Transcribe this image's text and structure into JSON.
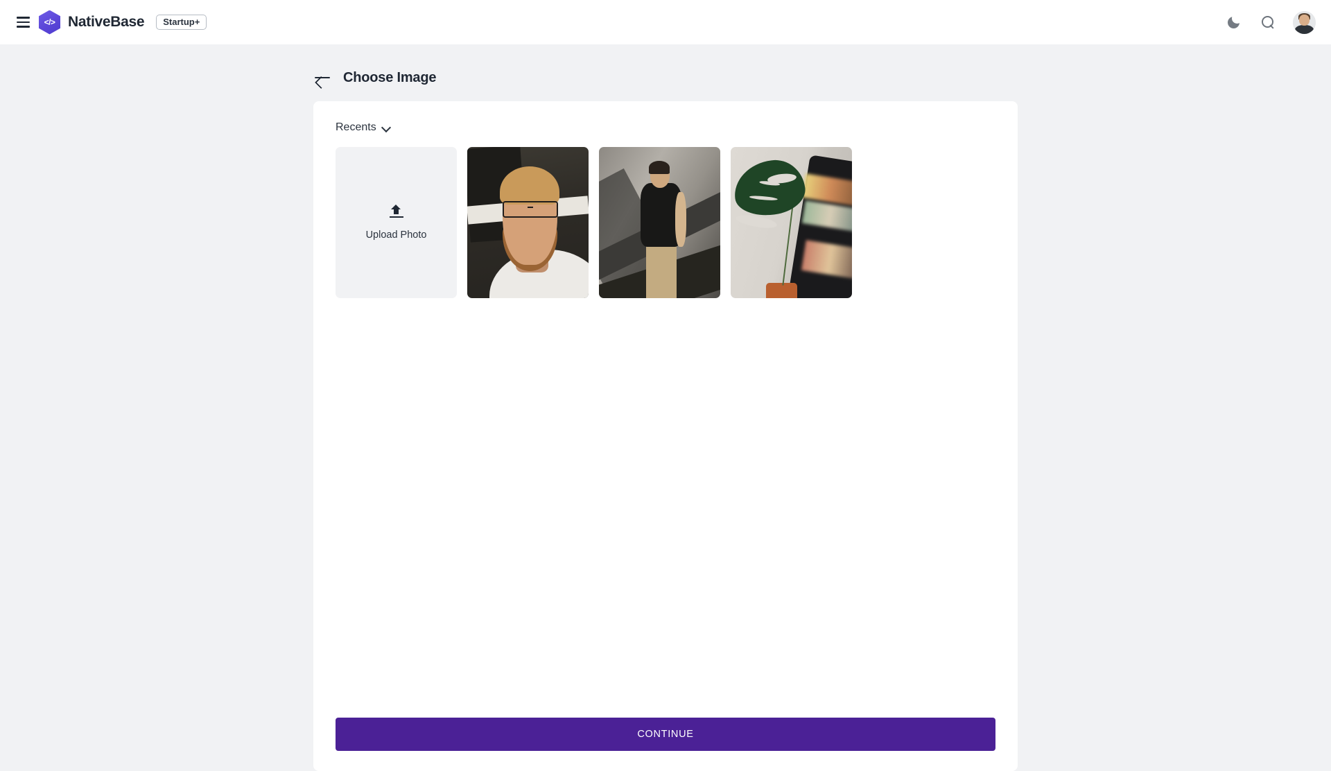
{
  "appbar": {
    "menu_icon": "hamburger-menu-icon",
    "logo_icon": "nativebase-hexagon-logo",
    "logo_glyph": "</>",
    "brand_name": "NativeBase",
    "plan_badge": "Startup+",
    "dark_mode_icon": "moon-icon",
    "search_icon": "search-icon",
    "avatar_label": "user-avatar"
  },
  "page": {
    "back_icon": "arrow-left-icon",
    "title": "Choose Image"
  },
  "card": {
    "filter": {
      "label": "Recents",
      "chevron_icon": "chevron-down-icon"
    },
    "upload_tile": {
      "icon": "upload-icon",
      "label": "Upload Photo"
    },
    "photos": [
      {
        "alt": "Portrait of bearded man with glasses in white t-shirt"
      },
      {
        "alt": "Man in black t-shirt and khaki pants near concrete stairs"
      },
      {
        "alt": "Monstera plant leaf beside a phone screen"
      }
    ],
    "continue_label": "CONTINUE"
  },
  "colors": {
    "accent_purple": "#4b2196",
    "logo_purple": "#5b46d8",
    "page_background": "#f1f2f4",
    "card_background": "#ffffff",
    "text_primary": "#1f2733"
  }
}
